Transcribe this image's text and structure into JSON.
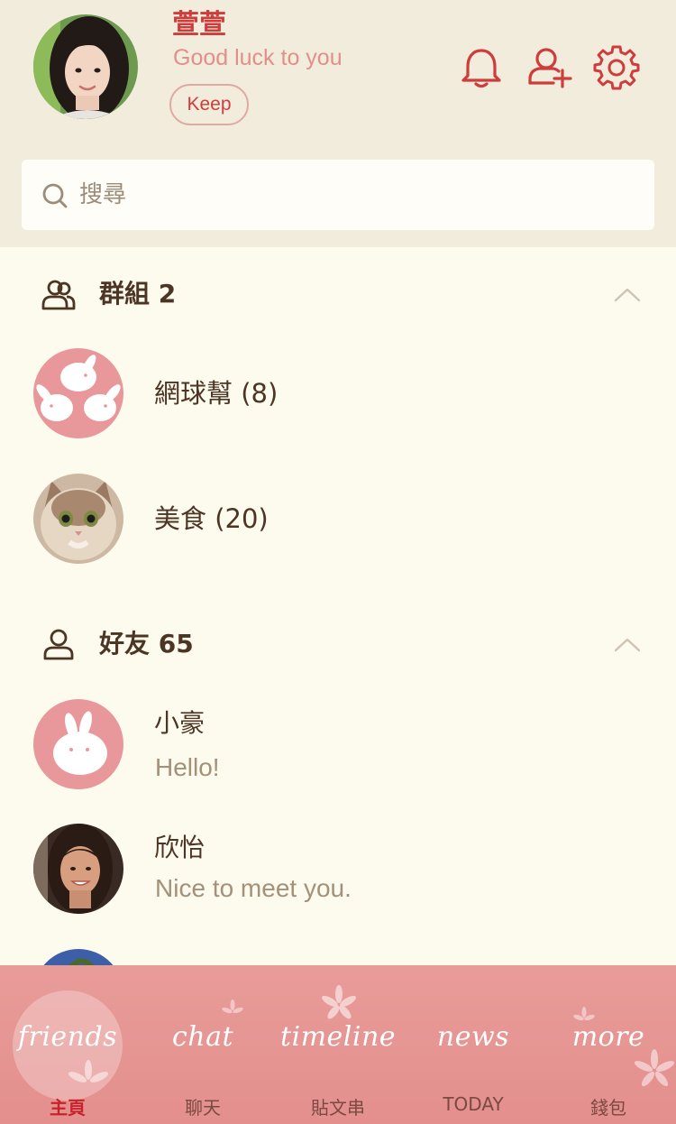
{
  "profile": {
    "name": "萱萱",
    "status": "Good luck to you",
    "keep_label": "Keep"
  },
  "search": {
    "placeholder": "搜尋"
  },
  "groups": {
    "title": "群組 2",
    "items": [
      {
        "name": "網球幫 (8)"
      },
      {
        "name": "美食 (20)"
      }
    ]
  },
  "friends": {
    "title": "好友 65",
    "items": [
      {
        "name": "小豪",
        "message": "Hello!"
      },
      {
        "name": "欣怡",
        "message": "Nice to meet you."
      }
    ]
  },
  "nav": {
    "items": [
      {
        "script": "friends",
        "label": "主頁",
        "active": true
      },
      {
        "script": "chat",
        "label": "聊天"
      },
      {
        "script": "timeline",
        "label": "貼文串"
      },
      {
        "script": "news",
        "label": "TODAY"
      },
      {
        "script": "more",
        "label": "錢包"
      }
    ]
  },
  "icons": {
    "header": [
      "bell-icon",
      "add-friend-icon",
      "gear-icon"
    ],
    "search": "search-icon",
    "sections": [
      "group-icon",
      "person-icon",
      "chevron-up-icon"
    ]
  },
  "colors": {
    "accent": "#cf3c3c",
    "status_text": "#e28f8a",
    "header_bg": "#f2ecdd",
    "page_bg": "#fdfaee",
    "nav_bg": "#e89c99",
    "nav_active": "#c8232b"
  }
}
